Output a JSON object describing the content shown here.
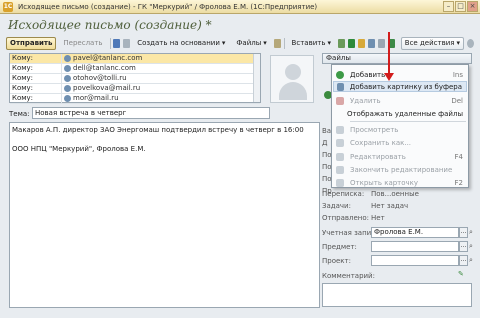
{
  "window": {
    "title": "Исходящее письмо (создание) - ГК \"Меркурий\" / Фролова Е.М.   (1С:Предприятие)"
  },
  "form": {
    "heading": "Исходящее письмо (создание)",
    "modified_mark": "*"
  },
  "toolbar": {
    "send": "Отправить",
    "forward": "Переслать",
    "create_based": "Создать на основании",
    "files": "Файлы",
    "insert": "Вставить",
    "all_actions": "Все действия"
  },
  "recipients": [
    {
      "type": "Кому:",
      "address": "pavel@tanlanc.com"
    },
    {
      "type": "Кому:",
      "address": "dell@tanlanc.com"
    },
    {
      "type": "Кому:",
      "address": "otohov@tolli.ru"
    },
    {
      "type": "Кому:",
      "address": "povelkova@mail.ru"
    },
    {
      "type": "Кому:",
      "address": "mor@mail.ru"
    }
  ],
  "subject": {
    "label": "Тема:",
    "value": "Новая встреча в четверг"
  },
  "body": {
    "line1": "Макаров А.П. директор ЗАО Энергомаш подтвердил встречу в четверг в 16:00",
    "line2": "ООО НПЦ \"Меркурий\", Фролова Е.М."
  },
  "files_panel": {
    "header": "Файлы"
  },
  "context_menu": {
    "items": [
      {
        "label": "Добавить",
        "shortcut": "Ins",
        "state": "normal"
      },
      {
        "label": "Добавить картинку из буфера",
        "shortcut": "",
        "state": "highlight"
      },
      {
        "label": "Удалить",
        "shortcut": "Del",
        "state": "disabled"
      },
      {
        "label": "Отображать удаленные файлы",
        "shortcut": "",
        "state": "normal"
      },
      {
        "label": "Просмотреть",
        "shortcut": "",
        "state": "disabled"
      },
      {
        "label": "Сохранить как...",
        "shortcut": "",
        "state": "disabled"
      },
      {
        "label": "Редактировать",
        "shortcut": "F4",
        "state": "disabled"
      },
      {
        "label": "Закончить редактирование",
        "shortcut": "",
        "state": "disabled"
      },
      {
        "label": "Открыть карточку",
        "shortcut": "F2",
        "state": "disabled"
      }
    ]
  },
  "details": {
    "partial_labels": [
      "Ва",
      "Д",
      "По",
      "По",
      "По",
      "Пр"
    ],
    "transfer_label": "Переписка:",
    "transfer_value": "Пов...оенные",
    "tasks_label": "Задачи:",
    "tasks_value": "Нет задач",
    "sent_label": "Отправлено:",
    "sent_value": "Нет",
    "account_label": "Учетная запись:",
    "account_value": "Фролова Е.М.",
    "subject_label": "Предмет:",
    "project_label": "Проект:",
    "comment_label": "Комментарий:"
  },
  "colors": {
    "title_bar": "#ecdca3",
    "heading": "#4e5e3a",
    "selected_row": "#fbe7a6",
    "menu_highlight": "#dde8f4",
    "arrow": "#d21c1c"
  }
}
